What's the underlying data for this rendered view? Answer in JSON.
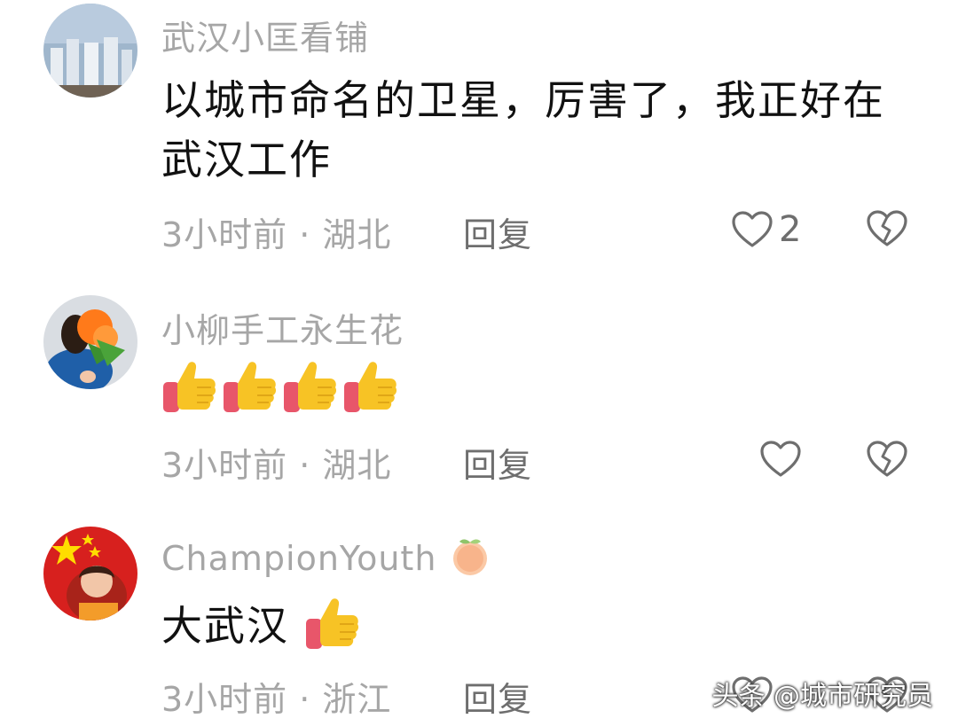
{
  "comments": [
    {
      "username": "武汉小匡看铺",
      "content": "以城市命名的卫星，厉害了，我正好在武汉工作",
      "time": "3小时前",
      "location": "湖北",
      "meta": "3小时前 · 湖北",
      "reply_label": "回复",
      "like_count": "2"
    },
    {
      "username": "小柳手工永生花",
      "content_emojis": [
        "thumbs-up",
        "thumbs-up",
        "thumbs-up",
        "thumbs-up"
      ],
      "time": "3小时前",
      "location": "湖北",
      "meta": "3小时前 · 湖北",
      "reply_label": "回复"
    },
    {
      "username": "ChampionYouth",
      "username_badge": "peach-icon",
      "content": "大武汉",
      "content_emojis": [
        "thumbs-up"
      ],
      "time": "3小时前",
      "location": "浙江",
      "meta": "3小时前 · 浙江",
      "reply_label": "回复"
    }
  ],
  "watermark": "头条 @城市研究员",
  "colors": {
    "meta_gray": "#a6a6a6",
    "text": "#111111",
    "accent_red": "#d7201e",
    "thumb_yellow": "#f7c325"
  }
}
